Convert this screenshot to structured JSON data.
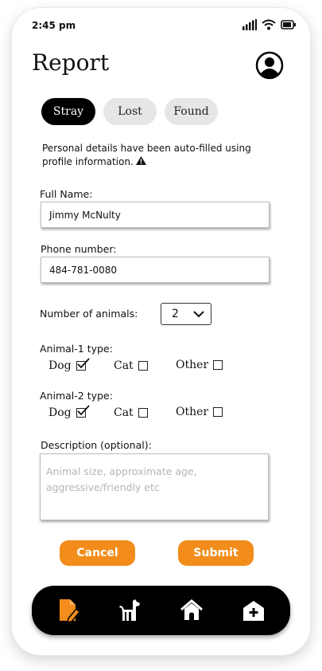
{
  "status": {
    "time": "2:45 pm"
  },
  "header": {
    "title": "Report"
  },
  "tabs": [
    {
      "label": "Stray",
      "active": true
    },
    {
      "label": "Lost",
      "active": false
    },
    {
      "label": "Found",
      "active": false
    }
  ],
  "notice": {
    "text": "Personal details have been auto-filled using profile information."
  },
  "form": {
    "full_name_label": "Full Name:",
    "full_name_value": "Jimmy McNulty",
    "phone_label": "Phone number:",
    "phone_value": "484-781-0080",
    "num_animals_label": "Number of animals:",
    "num_animals_value": "2",
    "animal1_label": "Animal-1 type:",
    "animal2_label": "Animal-2 type:",
    "type_options": [
      "Dog",
      "Cat",
      "Other"
    ],
    "animal1_selected": "Dog",
    "animal2_selected": "Dog",
    "description_label": "Description (optional):",
    "description_placeholder": "Animal size, approximate age, aggressive/friendly etc"
  },
  "actions": {
    "cancel_label": "Cancel",
    "submit_label": "Submit"
  },
  "colors": {
    "accent": "#f28c1b",
    "nav_bg": "#000000",
    "tab_active_bg": "#000000",
    "tab_inactive_bg": "#e6e6e6"
  },
  "nav": [
    {
      "icon": "report-document-icon",
      "active": true
    },
    {
      "icon": "dog-icon",
      "active": false
    },
    {
      "icon": "shelter-home-icon",
      "active": false
    },
    {
      "icon": "vet-hospital-icon",
      "active": false
    }
  ]
}
